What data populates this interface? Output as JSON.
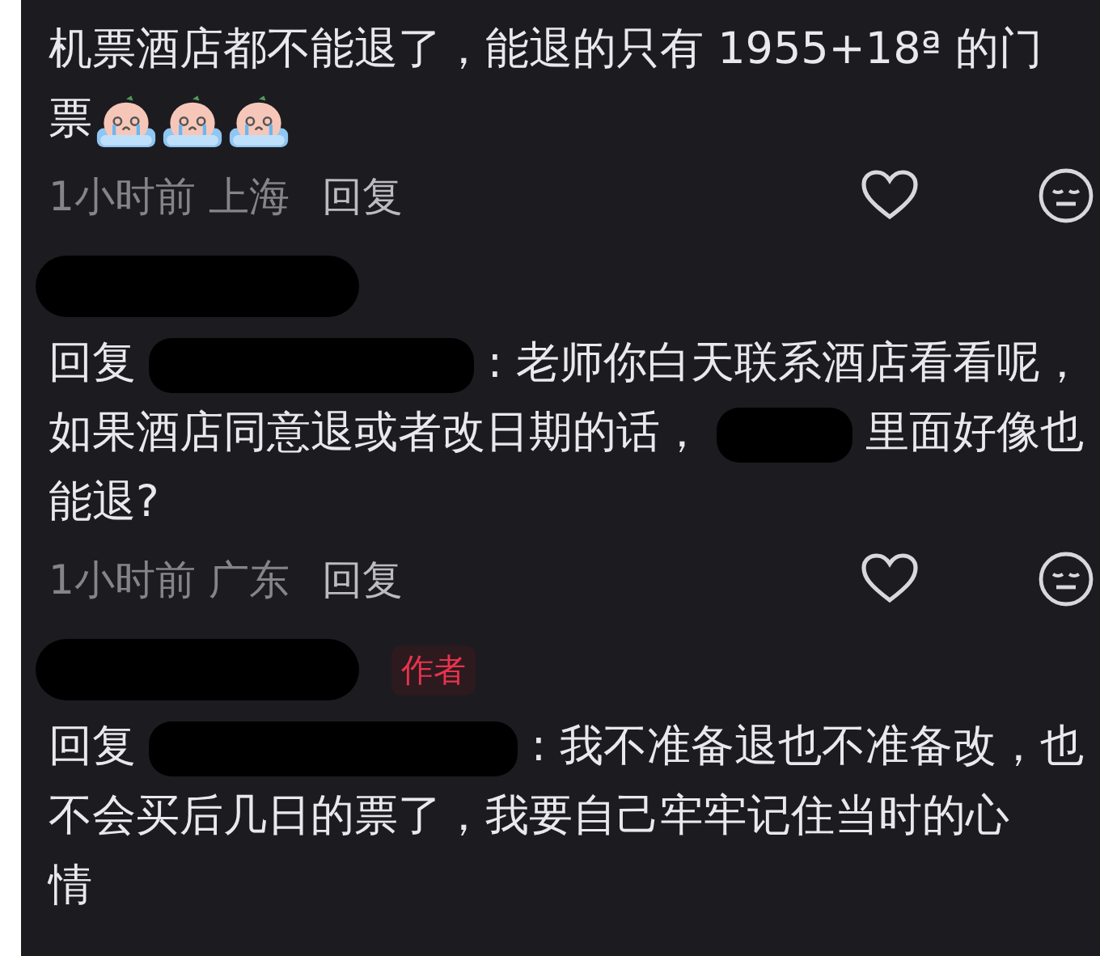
{
  "comments": [
    {
      "lines": [
        [
          {
            "kind": "text",
            "text": "机票酒店都不能退了，能退的只有 1955+18ª 的门"
          }
        ],
        [
          {
            "kind": "text",
            "text": "票"
          },
          {
            "kind": "sticker"
          },
          {
            "kind": "sticker"
          },
          {
            "kind": "sticker"
          }
        ]
      ],
      "time": "1小时前",
      "location": "上海",
      "reply": "回复",
      "liked": false
    },
    {
      "header": {
        "hidden_name": true
      },
      "lines": [
        [
          {
            "kind": "text",
            "text": "回复"
          },
          {
            "kind": "redacted"
          },
          {
            "kind": "text",
            "text": ": 老师你白天联系酒店看看呢，"
          }
        ],
        [
          {
            "kind": "text",
            "text": "如果酒店同意退或者改日期的话，"
          },
          {
            "kind": "redacted"
          },
          {
            "kind": "text",
            "text": "里面好像也"
          }
        ],
        [
          {
            "kind": "text",
            "text": "能退?"
          }
        ]
      ],
      "time": "1小时前",
      "location": "广东",
      "reply": "回复",
      "liked": false
    },
    {
      "header": {
        "hidden_name": true,
        "badge": "作者"
      },
      "lines": [
        [
          {
            "kind": "text",
            "text": "回复"
          },
          {
            "kind": "redacted"
          },
          {
            "kind": "text",
            "text": ": 我不准备退也不准备改，也"
          }
        ],
        [
          {
            "kind": "text",
            "text": "不会买后几日的票了，我要自己牢牢记住当时的心"
          }
        ],
        [
          {
            "kind": "text",
            "text": "情"
          }
        ]
      ]
    }
  ]
}
